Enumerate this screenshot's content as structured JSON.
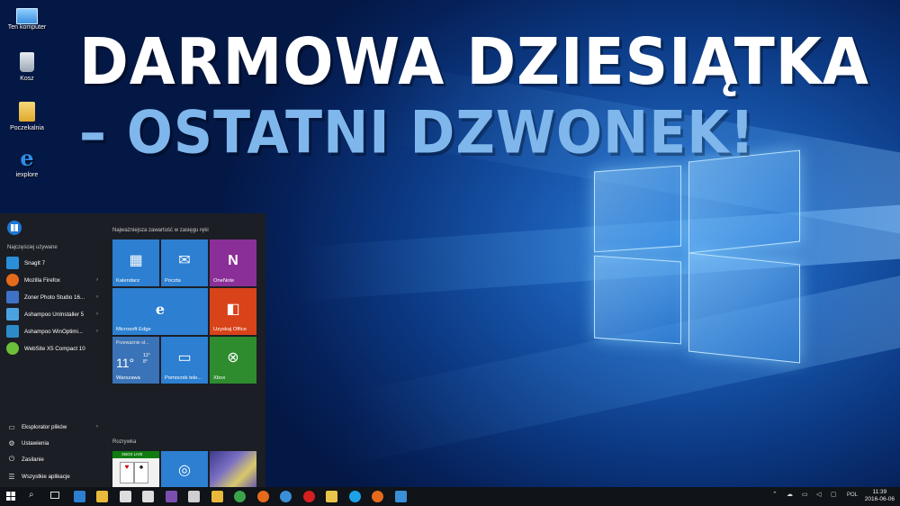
{
  "headline": {
    "line1": "DARMOWA DZIESIĄTKA",
    "line2": "– OSTATNI DZWONEK!"
  },
  "desktop_icons": [
    {
      "label": "Ten komputer",
      "icon": "computer-icon"
    },
    {
      "label": "Kosz",
      "icon": "recycle-bin-icon"
    },
    {
      "label": "Poczekalnia",
      "icon": "folder-icon"
    },
    {
      "label": "iexplore",
      "icon": "internet-explorer-icon"
    }
  ],
  "start_menu": {
    "most_used_title": "Najczęściej używane",
    "most_used": [
      {
        "label": "SnagIt 7",
        "color": "#2a8fd8"
      },
      {
        "label": "Mozilla Firefox",
        "color": "#e66a1c"
      },
      {
        "label": "Zoner Photo Studio 16...",
        "color": "#3f72c7"
      },
      {
        "label": "Ashampoo UnInstaller 5",
        "color": "#4aa3e0"
      },
      {
        "label": "Ashampoo WinOptimi...",
        "color": "#2b8cc9"
      },
      {
        "label": "WebSite X5 Compact 10",
        "color": "#6cbf3a"
      }
    ],
    "bottom": [
      {
        "label": "Eksplorator plików",
        "icon": "folder-icon"
      },
      {
        "label": "Ustawienia",
        "icon": "gear-icon"
      },
      {
        "label": "Zasilanie",
        "icon": "power-icon"
      },
      {
        "label": "Wszystkie aplikacje",
        "icon": "list-icon"
      }
    ],
    "group1_title": "Najważniejsza zawartość w zasięgu ręki",
    "tiles": [
      {
        "label": "Kalendarz",
        "color": "#2c7fd1",
        "glyph": "▦"
      },
      {
        "label": "Poczta",
        "color": "#2c7fd1",
        "glyph": "✉"
      },
      {
        "label": "OneNote",
        "color": "#8a2f97",
        "glyph": "N"
      },
      {
        "label": "Microsoft Edge",
        "color": "#2c7fd1",
        "glyph": "e"
      },
      {
        "label": "Uzyskaj Office",
        "color": "#d8431a",
        "glyph": "◧"
      },
      {
        "label": "Warszawa",
        "color": "#3a73b8",
        "glyph": "11°"
      },
      {
        "label": "Pomocnik tele...",
        "color": "#2c7fd1",
        "glyph": "▭"
      },
      {
        "label": "Xbox",
        "color": "#2e8b2e",
        "glyph": "⊗"
      }
    ],
    "weather": {
      "subtitle": "Przeważnie sł...",
      "hi": "12°",
      "lo": "8°"
    },
    "group2_title": "Rozrywka",
    "xbox_live_label": "XBOX LIVE"
  },
  "taskbar": {
    "apps": [
      {
        "icon": "edge-icon",
        "color": "#2c7fd1"
      },
      {
        "icon": "file-explorer-icon",
        "color": "#e8b93a"
      },
      {
        "icon": "mail-icon",
        "color": "#dddddd"
      },
      {
        "icon": "store-icon",
        "color": "#dddddd"
      },
      {
        "icon": "save-app-icon",
        "color": "#7b4fb0"
      },
      {
        "icon": "feather-icon",
        "color": "#cfcfcf"
      },
      {
        "icon": "folder-icon",
        "color": "#e8b93a"
      },
      {
        "icon": "chrome-icon",
        "color": "#3aa34a"
      },
      {
        "icon": "firefox-icon",
        "color": "#e66a1c"
      },
      {
        "icon": "network-app-icon",
        "color": "#3a8fd8"
      },
      {
        "icon": "opera-icon",
        "color": "#d42020"
      },
      {
        "icon": "document-icon",
        "color": "#e8c44a"
      },
      {
        "icon": "skype-icon",
        "color": "#1da1e8"
      },
      {
        "icon": "firefox2-icon",
        "color": "#e66a1c"
      },
      {
        "icon": "settings-app-icon",
        "color": "#3a8fd8"
      }
    ],
    "language": "POL",
    "time": "11:39",
    "date": "2016-06-06"
  }
}
